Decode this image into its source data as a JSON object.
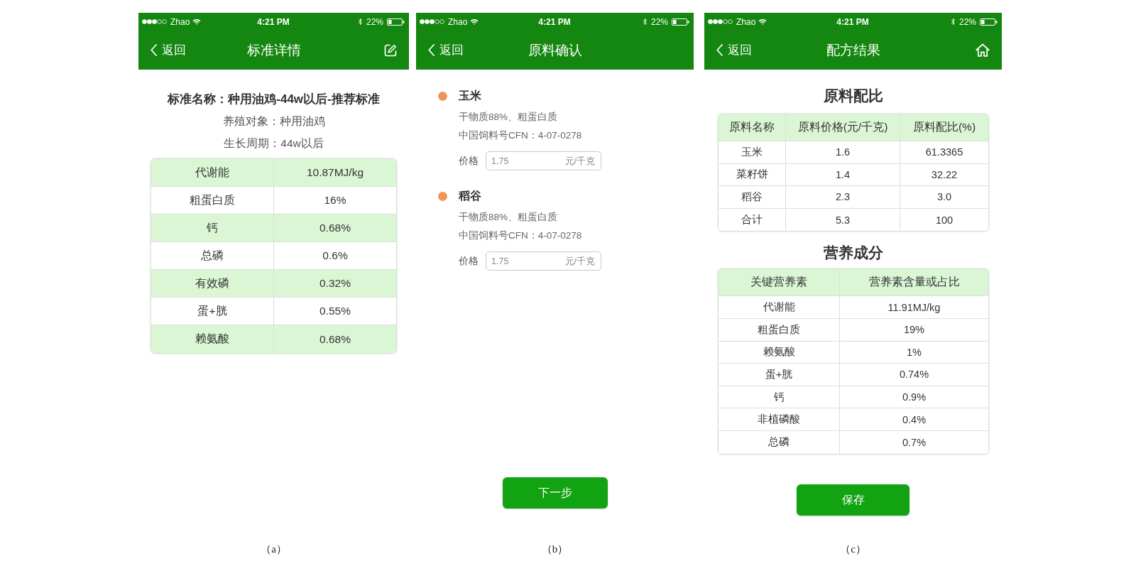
{
  "screens": [
    {
      "kind": "standard",
      "status_bar": {
        "carrier": "Zhao",
        "time": "4:21 PM",
        "battery": "22%"
      },
      "nav_bar": {
        "back": "返回",
        "title": "标准详情"
      },
      "heading": "标准名称：种用油鸡-44w以后-推荐标准",
      "info": [
        "养殖对象：种用油鸡",
        "生长周期：44w以后"
      ],
      "table": {
        "rows": [
          [
            "代谢能",
            "10.87MJ/kg"
          ],
          [
            "粗蛋白质",
            "16%"
          ],
          [
            "钙",
            "0.68%"
          ],
          [
            "总磷",
            "0.6%"
          ],
          [
            "有效磷",
            "0.32%"
          ],
          [
            "蛋+胱",
            "0.55%"
          ],
          [
            "赖氨酸",
            "0.68%"
          ]
        ]
      },
      "caption": "（a）"
    },
    {
      "kind": "ingredients",
      "status_bar": {
        "carrier": "Zhao",
        "time": "4:21 PM",
        "battery": "22%"
      },
      "nav_bar": {
        "back": "返回",
        "title": "原料确认"
      },
      "items": [
        {
          "name": "玉米",
          "details": [
            "干物质88%、粗蛋白质",
            "中国饲料号CFN：4-07-0278"
          ],
          "price": {
            "label": "价格",
            "value": "1.75",
            "unit": "元/千克"
          }
        },
        {
          "name": "稻谷",
          "details": [
            "干物质88%、粗蛋白质",
            "中国饲料号CFN：4-07-0278"
          ],
          "price": {
            "label": "价格",
            "value": "1.75",
            "unit": "元/千克"
          }
        }
      ],
      "button": "下一步",
      "caption": "（b）"
    },
    {
      "kind": "result",
      "status_bar": {
        "carrier": "Zhao",
        "time": "4:21 PM",
        "battery": "22%"
      },
      "nav_bar": {
        "back": "返回",
        "title": "配方结果"
      },
      "sections": [
        {
          "title": "原料配比",
          "columns": [
            "原料名称",
            "原料价格(元/千克)",
            "原料配比(%)"
          ],
          "rows": [
            [
              "玉米",
              "1.6",
              "61.3365"
            ],
            [
              "菜籽饼",
              "1.4",
              "32.22"
            ],
            [
              "稻谷",
              "2.3",
              "3.0"
            ],
            [
              "合计",
              "5.3",
              "100"
            ]
          ]
        },
        {
          "title": "营养成分",
          "columns": [
            "关键营养素",
            "营养素含量或占比"
          ],
          "rows": [
            [
              "代谢能",
              "11.91MJ/kg"
            ],
            [
              "粗蛋白质",
              "19%"
            ],
            [
              "赖氨酸",
              "1%"
            ],
            [
              "蛋+胱",
              "0.74%"
            ],
            [
              "钙",
              "0.9%"
            ],
            [
              "非植磷酸",
              "0.4%"
            ],
            [
              "总磷",
              "0.7%"
            ]
          ]
        }
      ],
      "button": "保存",
      "caption": "（c）"
    }
  ]
}
